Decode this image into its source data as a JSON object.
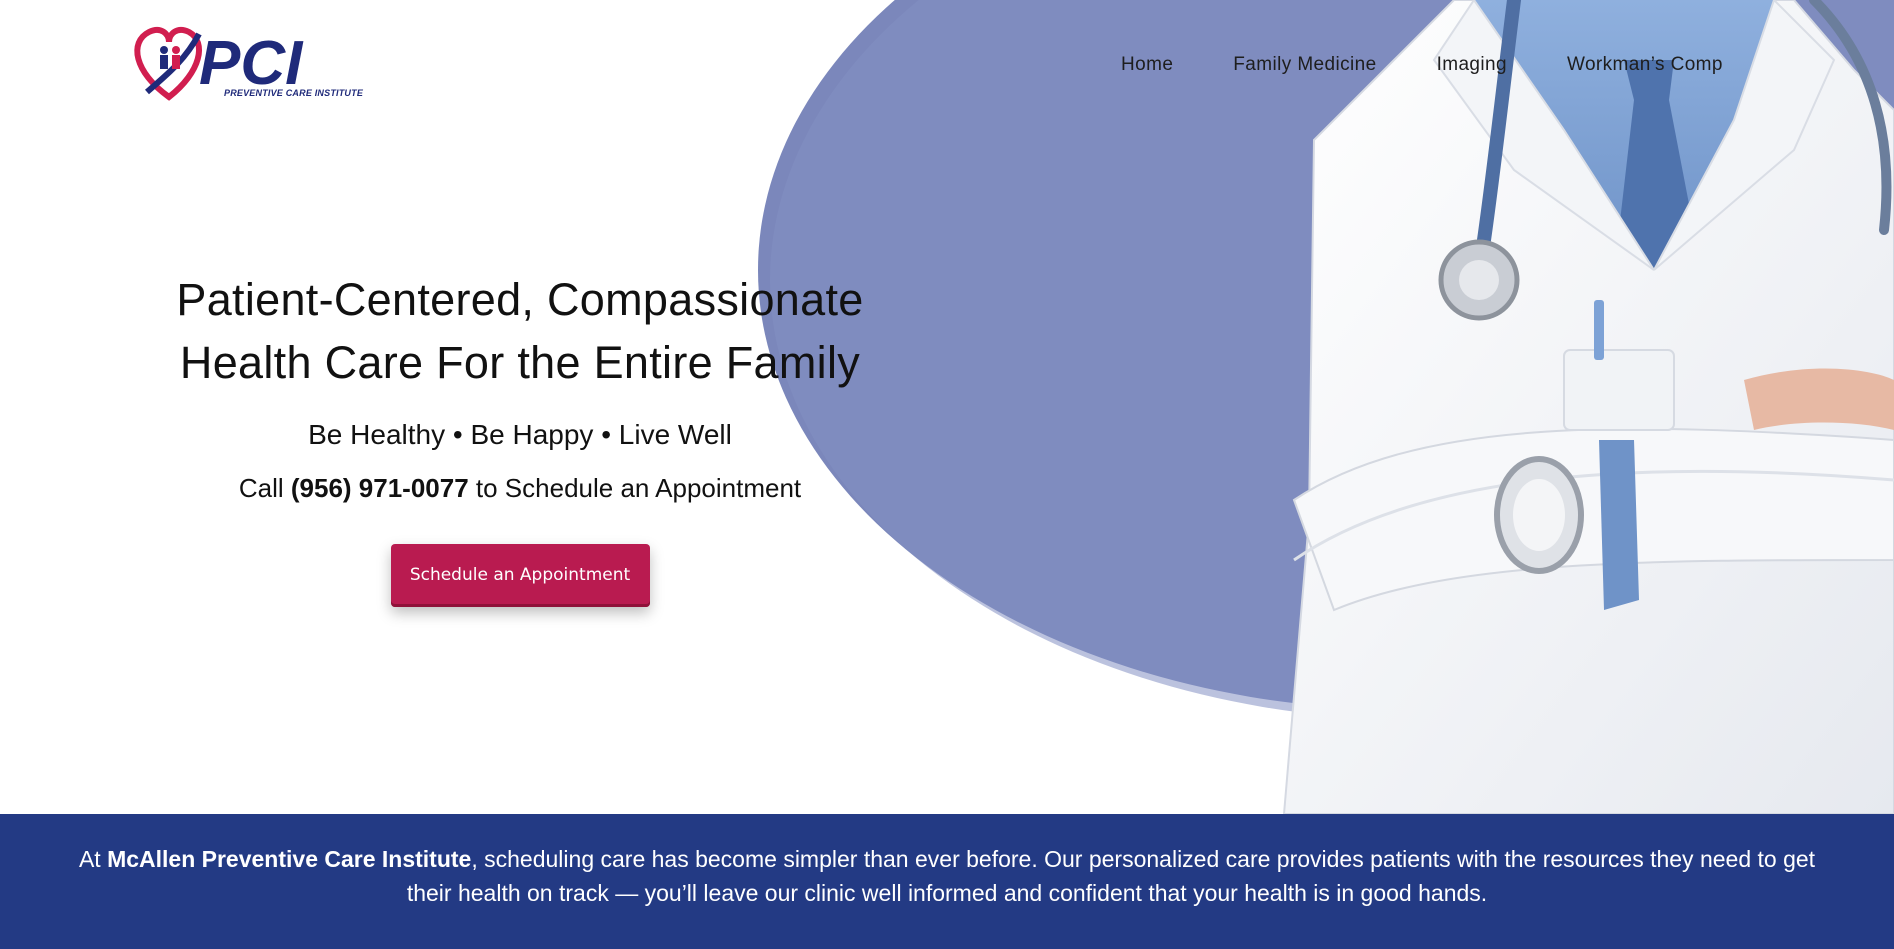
{
  "logo": {
    "name": "PCI",
    "subtitle": "PREVENTIVE CARE INSTITUTE"
  },
  "nav": {
    "items": [
      "Home",
      "Family Medicine",
      "Imaging",
      "Workman’s Comp"
    ]
  },
  "hero": {
    "headline_line1": "Patient-Centered, Compassionate",
    "headline_line2": "Health Care For the Entire Family",
    "tagline": "Be Healthy • Be Happy • Live Well",
    "call_prefix": "Call ",
    "phone": "(956) 971-0077",
    "call_suffix": " to Schedule an Appointment",
    "cta_label": "Schedule an Appointment"
  },
  "band": {
    "intro_prefix": "At ",
    "intro_bold": "McAllen Preventive Care Institute",
    "intro_rest": ", scheduling care has become simpler than ever before. Our personalized care provides patients with the resources they need to get their health on track — you’ll leave our clinic well informed and confident that your health is in good hands."
  },
  "colors": {
    "brand_blue": "#233a84",
    "accent_crimson": "#b91b50",
    "hero_blob": "#7b87bb"
  }
}
